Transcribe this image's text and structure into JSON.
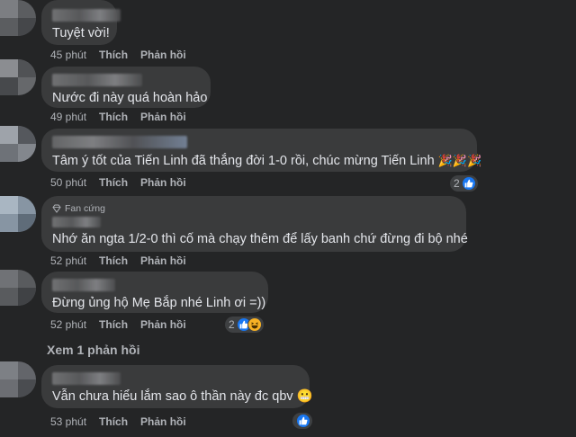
{
  "comments": [
    {
      "text": "Tuyệt vời!",
      "time": "45 phút",
      "like": "Thích",
      "reply": "Phản hồi"
    },
    {
      "text": "Nước đi này quá hoàn hảo",
      "time": "49 phút",
      "like": "Thích",
      "reply": "Phản hồi"
    },
    {
      "text": "Tâm ý tốt của Tiến Linh đã thắng đời 1-0 rồi, chúc mừng Tiến Linh",
      "time": "50 phút",
      "like": "Thích",
      "reply": "Phản hồi",
      "reaction_count": "2"
    },
    {
      "badge": "Fan cứng",
      "text": "Nhớ ăn ngta 1/2-0 thì cố mà chạy thêm để lấy banh chứ đừng đi bộ nhé",
      "time": "52 phút",
      "like": "Thích",
      "reply": "Phản hồi"
    },
    {
      "text": "Đừng ủng hộ Mẹ Bắp nhé Linh ơi =))",
      "time": "52 phút",
      "like": "Thích",
      "reply": "Phản hồi",
      "reaction_count": "2"
    },
    {
      "text": "Vẫn chưa hiểu lắm sao ô thần này đc qbv",
      "time": "53 phút",
      "like": "Thích",
      "reply": "Phản hồi"
    }
  ],
  "view_replies": "Xem 1 phản hồi",
  "colors": {
    "background": "#242526",
    "bubble": "#3a3b3c",
    "text": "#e4e6eb",
    "secondary": "#b0b3b8",
    "like_blue": "#1877f2"
  }
}
